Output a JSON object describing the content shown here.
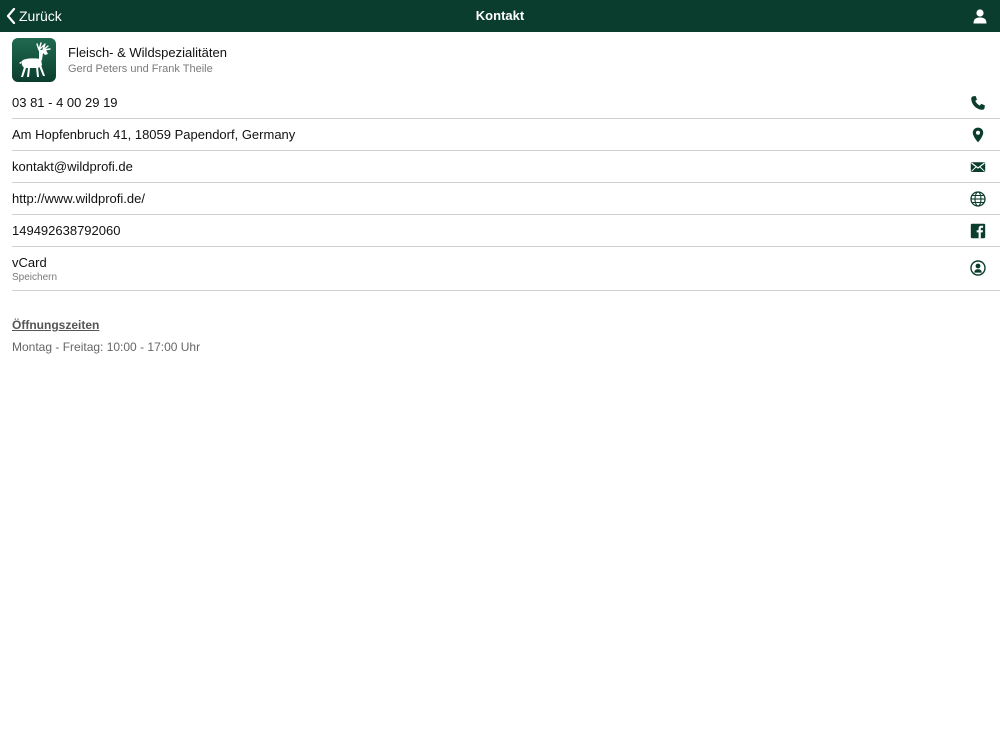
{
  "nav": {
    "back_label": "Zurück",
    "title": "Kontakt",
    "profile_icon": "user-icon"
  },
  "header": {
    "name": "Fleisch- & Wildspezialitäten",
    "owner": "Gerd Peters und Frank Theile",
    "logo_icon": "deer-logo"
  },
  "contacts": {
    "phone": {
      "label": "03 81 - 4 00 29 19",
      "icon": "phone-icon"
    },
    "address": {
      "label": "Am Hopfenbruch 41, 18059 Papendorf, Germany",
      "icon": "map-pin-icon"
    },
    "email": {
      "label": "kontakt@wildprofi.de",
      "icon": "envelope-icon"
    },
    "website": {
      "label": "http://www.wildprofi.de/",
      "icon": "globe-icon"
    },
    "facebook": {
      "label": "149492638792060",
      "icon": "facebook-icon"
    },
    "vcard": {
      "label": "vCard",
      "sublabel": "Speichern",
      "icon": "contact-card-icon"
    }
  },
  "hours": {
    "title": "Öffnungszeiten",
    "text": "Montag - Freitag: 10:00 - 17:00 Uhr"
  },
  "colors": {
    "brand": "#0b3d2e",
    "divider": "#d0d0d0",
    "secondary_text": "#7a7a7a"
  }
}
